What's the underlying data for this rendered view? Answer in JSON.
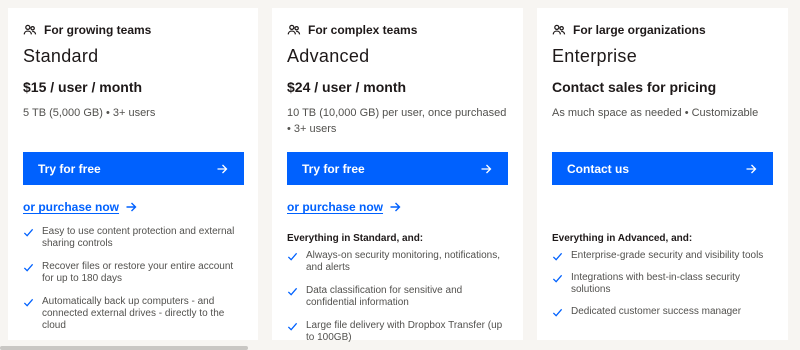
{
  "colors": {
    "accent": "#0061fe",
    "page_bg": "#f7f5f2",
    "card_bg": "#ffffff",
    "text": "#1e1919",
    "muted": "#52514e"
  },
  "plans": [
    {
      "tag": "For growing teams",
      "tag_icon": "users-icon",
      "name": "Standard",
      "price": "$15 / user / month",
      "description": "5 TB (5,000 GB) • 3+ users",
      "cta": "Try for free",
      "purchase": "or purchase now",
      "intro": "",
      "features": [
        "Easy to use content protection and external sharing controls",
        "Recover files or restore your entire account for up to 180 days",
        "Automatically back up computers - and connected external drives - directly to the cloud"
      ]
    },
    {
      "tag": "For complex teams",
      "tag_icon": "users-icon",
      "name": "Advanced",
      "price": "$24 / user / month",
      "description": "10 TB (10,000 GB) per user, once purchased • 3+ users",
      "cta": "Try for free",
      "purchase": "or purchase now",
      "intro": "Everything in Standard, and:",
      "features": [
        "Always-on security monitoring, notifications, and alerts",
        "Data classification for sensitive and confidential information",
        "Large file delivery with Dropbox Transfer (up to 100GB)"
      ]
    },
    {
      "tag": "For large organizations",
      "tag_icon": "users-icon",
      "name": "Enterprise",
      "price": "Contact sales for pricing",
      "description": "As much space as needed • Customizable",
      "cta": "Contact us",
      "purchase": "",
      "intro": "Everything in Advanced, and:",
      "features": [
        "Enterprise-grade security and visibility tools",
        "Integrations with best-in-class security solutions",
        "Dedicated customer success manager"
      ]
    }
  ]
}
